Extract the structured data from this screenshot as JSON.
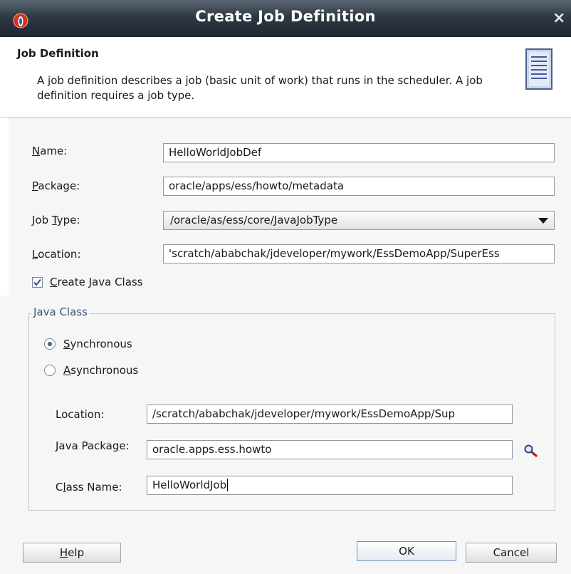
{
  "window": {
    "title": "Create Job Definition",
    "close_glyph": "×"
  },
  "header": {
    "title": "Job Definition",
    "description": "A job definition describes a job (basic unit of work) that runs in the scheduler.  A job definition requires a job type."
  },
  "form": {
    "name": {
      "label_mnemonic": "N",
      "label_rest": "ame:",
      "value": "HelloWorldJobDef"
    },
    "package": {
      "label_mnemonic": "P",
      "label_rest": "ackage:",
      "value": "oracle/apps/ess/howto/metadata"
    },
    "job_type": {
      "label_pre": "Job ",
      "label_mnemonic": "T",
      "label_rest": "ype:",
      "value": "/oracle/as/ess/core/JavaJobType"
    },
    "location": {
      "label_mnemonic": "L",
      "label_rest": "ocation:",
      "value": "'scratch/ababchak/jdeveloper/mywork/EssDemoApp/SuperEss"
    },
    "create_java_class": {
      "label_mnemonic": "C",
      "label_rest": "reate Java Class",
      "checked": true
    }
  },
  "java_class": {
    "group_title": "Java Class",
    "synchronous": {
      "label_mnemonic": "S",
      "label_rest": "ynchronous",
      "selected": true
    },
    "asynchronous": {
      "label_mnemonic": "A",
      "label_rest": "synchronous",
      "selected": false
    },
    "location": {
      "label": "Location:",
      "value": "/scratch/ababchak/jdeveloper/mywork/EssDemoApp/Sup"
    },
    "java_package": {
      "label_pre": "Java Packa",
      "label_mnemonic": "g",
      "label_rest": "e:",
      "value": "oracle.apps.ess.howto"
    },
    "class_name": {
      "label_pre": "C",
      "label_mnemonic": "l",
      "label_rest": "ass Name:",
      "value": "HelloWorldJob"
    }
  },
  "buttons": {
    "help": {
      "label_mnemonic": "H",
      "label_rest": "elp"
    },
    "ok": "OK",
    "cancel": "Cancel"
  },
  "colors": {
    "accent": "#3d5876",
    "titlebar": "#2f3944"
  },
  "icons": [
    "oracle-logo-icon",
    "document-icon",
    "search-icon",
    "checkmark-icon",
    "dropdown-arrow-icon"
  ]
}
